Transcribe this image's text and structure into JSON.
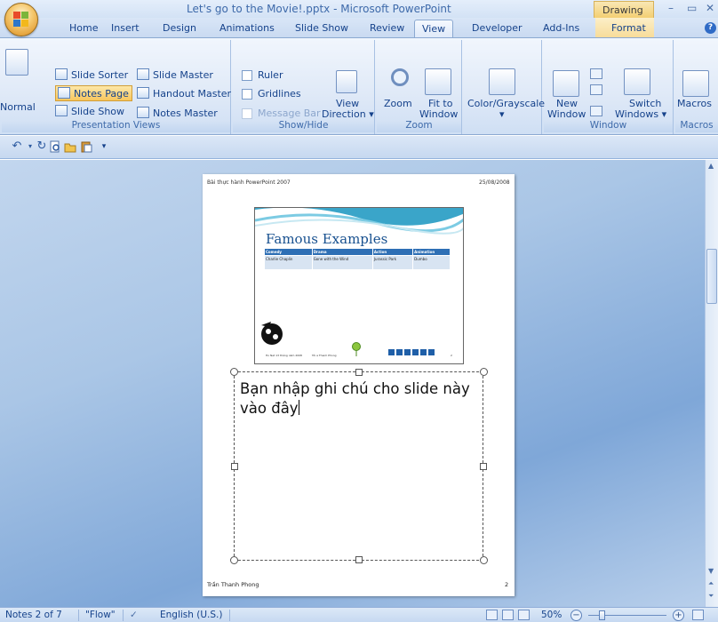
{
  "window": {
    "title": "Let's go to the Movie!.pptx - Microsoft PowerPoint",
    "contextual_tab": "Drawing ...",
    "min_glyph": "–",
    "max_glyph": "▭",
    "close_glyph": "✕"
  },
  "tabs": [
    "Home",
    "Insert",
    "Design",
    "Animations",
    "Slide Show",
    "Review",
    "View",
    "Developer",
    "Add-Ins",
    "Format"
  ],
  "ribbon": {
    "presentation_views": {
      "label": "Presentation Views",
      "normal": "Normal",
      "slide_sorter": "Slide Sorter",
      "notes_page": "Notes Page",
      "slide_show": "Slide Show",
      "slide_master": "Slide Master",
      "handout_master": "Handout Master",
      "notes_master": "Notes Master"
    },
    "show_hide": {
      "label": "Show/Hide",
      "ruler": "Ruler",
      "gridlines": "Gridlines",
      "message_bar": "Message Bar",
      "view_direction_1": "View",
      "view_direction_2": "Direction ▾"
    },
    "zoom": {
      "label": "Zoom",
      "zoom": "Zoom",
      "fit_1": "Fit to",
      "fit_2": "Window"
    },
    "color": {
      "label": "Color/Grayscale",
      "arrow": "▾"
    },
    "window": {
      "label": "Window",
      "new_1": "New",
      "new_2": "Window",
      "switch_1": "Switch",
      "switch_2": "Windows ▾"
    },
    "macros": {
      "label": "Macros",
      "macros": "Macros"
    }
  },
  "notes_page": {
    "header_left": "Bài thực hành PowerPoint 2007",
    "header_right": "25/08/2008",
    "footer_left": "Trần Thanh Phong",
    "footer_right": "2",
    "slide": {
      "title": "Famous Examples",
      "headers": [
        "Comedy",
        "Drama",
        "Action",
        "Animation"
      ],
      "row": [
        "Charlie Chaplin",
        "Gone with the Wind",
        "Jurassic Park",
        "Dumbo"
      ],
      "foot_left": "Ho Net 13 tháng năm 2008",
      "foot_mid": "Tôi a Thanh Phong",
      "foot_num": "2"
    },
    "notes_text": "Bạn nhập ghi chú cho slide này vào đây"
  },
  "status": {
    "page": "Notes 2 of 7",
    "theme": "\"Flow\"",
    "language": "English (U.S.)",
    "zoom": "50%",
    "minus": "−",
    "plus": "+"
  },
  "colors": {
    "ribbon_text": "#15428b",
    "selected": "#f8c65d",
    "table_header": "#2e6fb5"
  }
}
